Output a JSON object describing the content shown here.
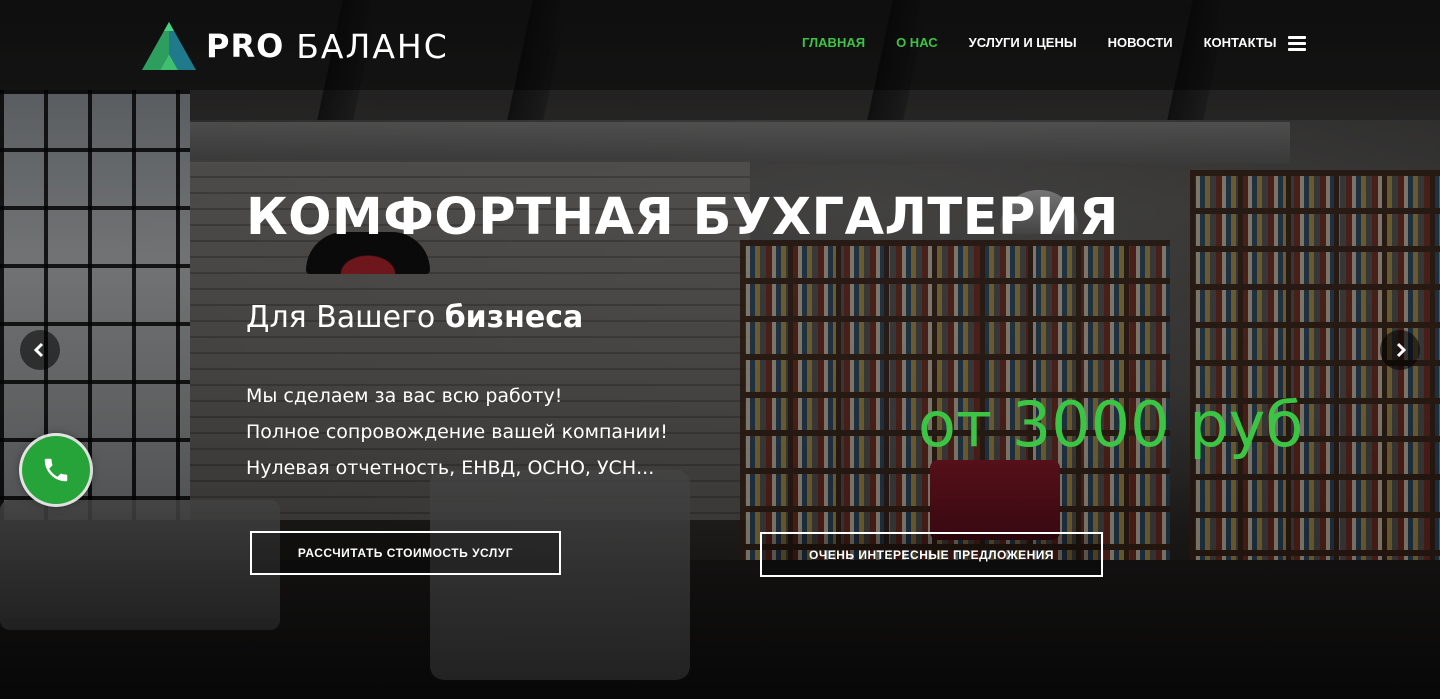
{
  "brand": {
    "pro": "PRO",
    "name": "БАЛАНС",
    "logo_colors": [
      "#2e9e5e",
      "#1f7a8c",
      "#3fbf6f"
    ]
  },
  "nav": {
    "items": [
      {
        "label": "ГЛАВНАЯ",
        "active": true
      },
      {
        "label": "О НАС",
        "active": true
      },
      {
        "label": "УСЛУГИ И ЦЕНЫ",
        "active": false
      },
      {
        "label": "НОВОСТИ",
        "active": false
      },
      {
        "label": "КОНТАКТЫ",
        "active": false
      }
    ],
    "menu_icon": "hamburger-icon"
  },
  "hero": {
    "title": "КОМФОРТНАЯ БУХГАЛТЕРИЯ",
    "subtitle_regular": "Для Вашего ",
    "subtitle_bold": "бизнеса",
    "lines": [
      "Мы сделаем за вас всю работу!",
      "Полное сопровождение вашей компании!",
      "Нулевая отчетность, ЕНВД, ОСНО, УСН..."
    ],
    "price": "от 3000 руб"
  },
  "buttons": {
    "calculate": "РАССЧИТАТЬ СТОИМОСТЬ УСЛУГ",
    "offers": "ОЧЕНЬ ИНТЕРЕСНЫЕ ПРЕДЛОЖЕНИЯ"
  },
  "slider": {
    "prev_icon": "chevron-left-icon",
    "next_icon": "chevron-right-icon"
  },
  "widgets": {
    "phone_icon": "phone-icon"
  },
  "colors": {
    "accent": "#3cc444",
    "phone_button": "#26a43a"
  }
}
